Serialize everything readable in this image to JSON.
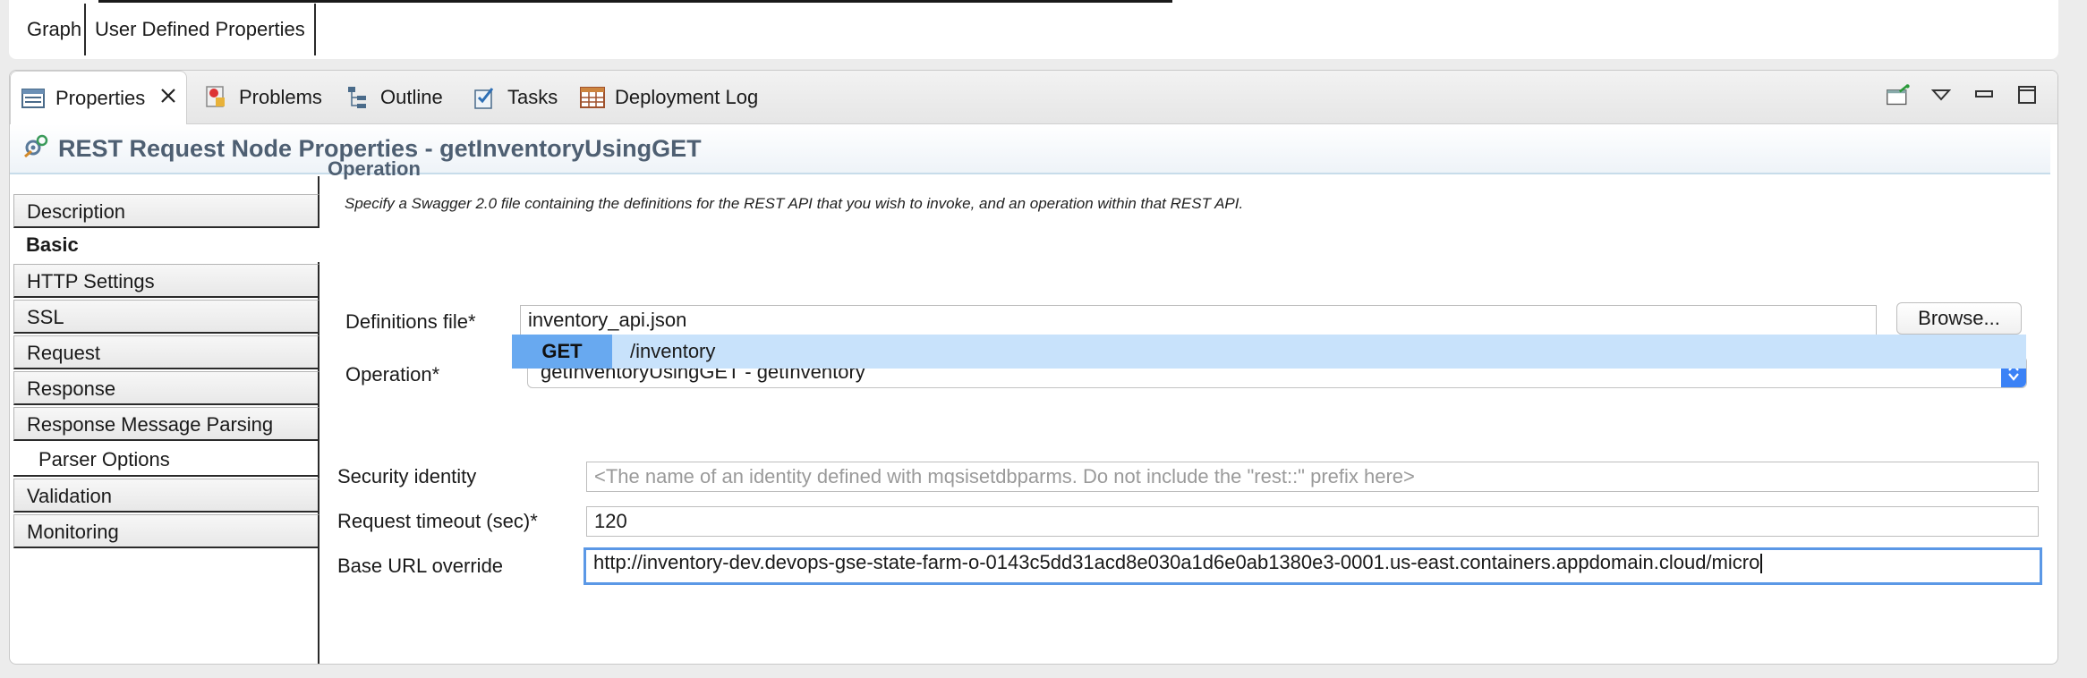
{
  "editor_tabs": [
    {
      "label": "Graph"
    },
    {
      "label": "User Defined Properties"
    }
  ],
  "view_tabs": [
    {
      "label": "Properties",
      "icon": "properties-icon",
      "active": true
    },
    {
      "label": "Problems",
      "icon": "problems-icon"
    },
    {
      "label": "Outline",
      "icon": "outline-icon"
    },
    {
      "label": "Tasks",
      "icon": "tasks-icon"
    },
    {
      "label": "Deployment Log",
      "icon": "table-icon"
    }
  ],
  "header": {
    "title": "REST Request Node Properties - getInventoryUsingGET"
  },
  "nav": [
    {
      "label": "Description"
    },
    {
      "label": "Basic"
    },
    {
      "label": "HTTP Settings"
    },
    {
      "label": "SSL"
    },
    {
      "label": "Request"
    },
    {
      "label": "Response"
    },
    {
      "label": "Response Message Parsing"
    },
    {
      "label": "Parser Options"
    },
    {
      "label": "Validation"
    },
    {
      "label": "Monitoring"
    }
  ],
  "operation": {
    "section_title": "Operation",
    "description": "Specify a Swagger 2.0 file containing the definitions for the REST API that you wish to invoke, and an operation within that REST API.",
    "definitions_label": "Definitions file*",
    "definitions_value": "inventory_api.json",
    "browse_label": "Browse...",
    "operation_label": "Operation*",
    "operation_value": "getInventoryUsingGET - getInventory",
    "method": "GET",
    "path": "/inventory"
  },
  "fields": {
    "security_label": "Security identity",
    "security_placeholder": "<The name of an identity defined with mqsisetdbparms. Do not include the \"rest::\" prefix here>",
    "timeout_label": "Request timeout (sec)*",
    "timeout_value": "120",
    "baseurl_label": "Base URL override",
    "baseurl_value": "http://inventory-dev.devops-gse-state-farm-o-0143c5dd31acd8e030a1d6e0ab1380e3-0001.us-east.containers.appdomain.cloud/micro"
  }
}
